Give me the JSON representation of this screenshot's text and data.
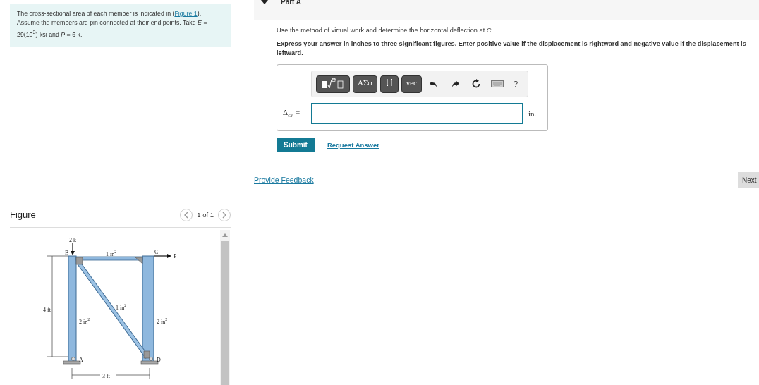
{
  "problem": {
    "before": "The cross-sectional area of each member is indicated in (",
    "link": "Figure 1",
    "after": "). Assume the members are pin connected at their end points. Take *E* = 29(10$^{3}$) ksi and *P* = 6 k."
  },
  "figure": {
    "title": "Figure",
    "counter": "1 of 1",
    "labels": [
      {
        "text": "2 k"
      },
      {
        "text": "B"
      },
      {
        "text": "1 in$^{2}$"
      },
      {
        "text": "C"
      },
      {
        "text": "P"
      },
      {
        "text": "1 in$^{2}$"
      },
      {
        "text": "4 ft"
      },
      {
        "text": "2 in$^{2}$"
      },
      {
        "text": "2 in$^{2}$"
      },
      {
        "text": "A"
      },
      {
        "text": "D"
      },
      {
        "text": "3 ft"
      }
    ]
  },
  "part": {
    "title": "Part A",
    "expanded": true
  },
  "question": "Use the method of virtual work and determine the horizontal deflection at *C*.",
  "instructions": "Express your answer in inches to three significant figures. Enter positive value if the displacement is rightward and negative value if the displacement is leftward.",
  "toolbar": [
    {
      "kind": "templates"
    },
    {
      "kind": "text",
      "label": "ΑΣφ"
    },
    {
      "kind": "arrows"
    },
    {
      "kind": "text",
      "label": "vec"
    },
    {
      "kind": "undo"
    },
    {
      "kind": "redo"
    },
    {
      "kind": "reset"
    },
    {
      "kind": "keyboard"
    },
    {
      "kind": "plain",
      "label": "?"
    }
  ],
  "answer": {
    "label": "Δ$_{Ch}$ =",
    "unit": "in."
  },
  "actions": {
    "submit": "Submit",
    "request": "Request Answer"
  },
  "feedback": "Provide Feedback",
  "next": "Next"
}
